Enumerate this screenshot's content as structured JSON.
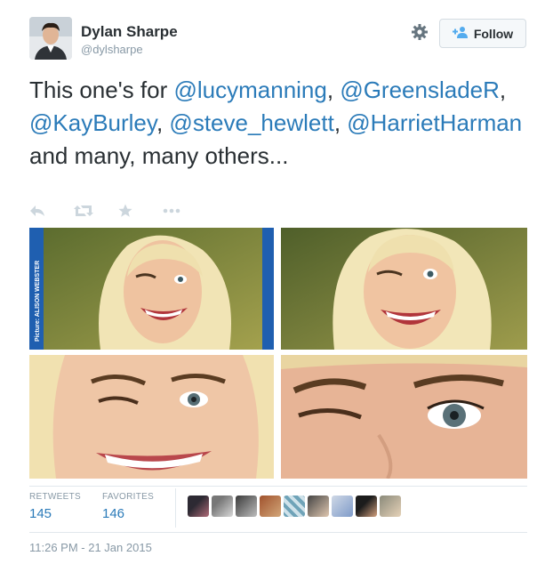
{
  "author": {
    "name": "Dylan Sharpe",
    "handle": "@dylsharpe"
  },
  "follow_button": {
    "label": "Follow"
  },
  "tweet": {
    "parts": [
      {
        "text": "This one's for ",
        "mention": false
      },
      {
        "text": "@lucymanning",
        "mention": true
      },
      {
        "text": ", ",
        "mention": false
      },
      {
        "text": "@GreensladeR",
        "mention": true
      },
      {
        "text": ", ",
        "mention": false
      },
      {
        "text": "@KayBurley",
        "mention": true
      },
      {
        "text": ", ",
        "mention": false
      },
      {
        "text": "@steve_hewlett",
        "mention": true
      },
      {
        "text": ", ",
        "mention": false
      },
      {
        "text": "@HarrietHarman",
        "mention": true
      },
      {
        "text": " and many, many others...",
        "mention": false
      }
    ]
  },
  "actions": [
    "reply-icon",
    "retweet-icon",
    "favorite-icon",
    "more-icon"
  ],
  "photos": {
    "caption": "Picture: ALISON WEBSTER",
    "items": [
      "photo-full-wink",
      "photo-crop-wink",
      "photo-closeup-smile",
      "photo-closeup-eye"
    ]
  },
  "stats": {
    "retweets_label": "RETWEETS",
    "retweets": "145",
    "favorites_label": "FAVORITES",
    "favorites": "146"
  },
  "favoriters": [
    "favoriter-avatar-1",
    "favoriter-avatar-2",
    "favoriter-avatar-3",
    "favoriter-avatar-4",
    "favoriter-avatar-5",
    "favoriter-avatar-6",
    "favoriter-avatar-7",
    "favoriter-avatar-8",
    "favoriter-avatar-9"
  ],
  "colors": {
    "mention": "#2b7bb9",
    "text": "#292f33",
    "muted": "#8899a6"
  },
  "timestamp": "11:26 PM - 21 Jan 2015"
}
